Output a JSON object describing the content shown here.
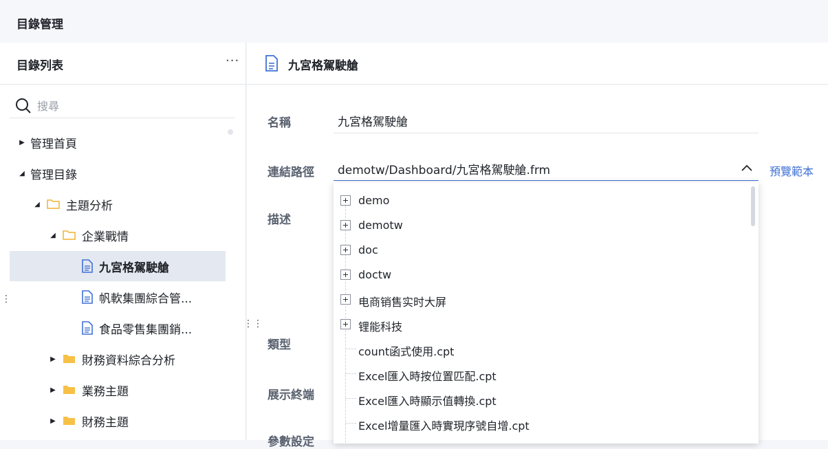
{
  "app": {
    "title": "目錄管理"
  },
  "left_panel": {
    "title": "目錄列表",
    "more_label": "···",
    "search": {
      "placeholder": "搜尋",
      "value": ""
    },
    "tree": [
      {
        "label": "管理首頁",
        "expanded": false,
        "type": "node"
      },
      {
        "label": "管理目錄",
        "expanded": true,
        "type": "node"
      },
      {
        "label": "主題分析",
        "expanded": true,
        "type": "folder"
      },
      {
        "label": "企業戰情",
        "expanded": true,
        "type": "folder"
      },
      {
        "label": "九宮格駕駛艙",
        "type": "file",
        "selected": true
      },
      {
        "label": "帆軟集團綜合管...",
        "type": "file"
      },
      {
        "label": "食品零售集團銷...",
        "type": "file"
      },
      {
        "label": "財務資料綜合分析",
        "expanded": false,
        "type": "folder-closed"
      },
      {
        "label": "業務主題",
        "expanded": false,
        "type": "folder-closed"
      },
      {
        "label": "財務主題",
        "expanded": false,
        "type": "folder-closed"
      }
    ]
  },
  "right_panel": {
    "title": "九宮格駕駛艙",
    "fields": {
      "name_label": "名稱",
      "name_value": "九宮格駕駛艙",
      "path_label": "連結路徑",
      "path_value": "demotw/Dashboard/九宮格駕駛艙.frm",
      "preview_label": "預覽範本",
      "desc_label": "描述",
      "type_label": "類型",
      "terminal_label": "展示終端",
      "params_label": "參數設定"
    }
  },
  "dropdown": {
    "items": [
      {
        "label": "demo",
        "expandable": true
      },
      {
        "label": "demotw",
        "expandable": true
      },
      {
        "label": "doc",
        "expandable": true
      },
      {
        "label": "doctw",
        "expandable": true
      },
      {
        "label": "电商销售实时大屏",
        "expandable": true
      },
      {
        "label": "锂能科技",
        "expandable": true
      },
      {
        "label": "count函式使用.cpt",
        "expandable": false
      },
      {
        "label": "Excel匯入時按位置匹配.cpt",
        "expandable": false
      },
      {
        "label": "Excel匯入時顯示值轉換.cpt",
        "expandable": false
      },
      {
        "label": "Excel增量匯入時實現序號自增.cpt",
        "expandable": false
      }
    ]
  },
  "colors": {
    "accent": "#3f71d6",
    "folder": "#f7c046",
    "selected_bg": "#e4e8f0"
  }
}
